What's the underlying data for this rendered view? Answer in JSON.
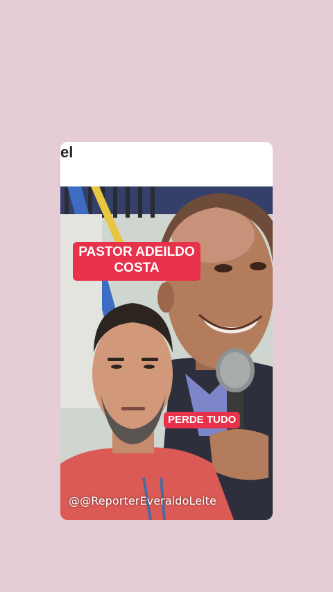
{
  "header": {
    "partial_text": "el"
  },
  "video": {
    "caption_line1": "PASTOR ADEILDO",
    "caption_line2": "COSTA",
    "caption_secondary": "PERDE TUDO",
    "watermark": "@@ReporterEveraldoLeite"
  },
  "colors": {
    "page_background": "#e6cdd5",
    "caption_background": "#e8314a",
    "caption_text": "#ffffff"
  }
}
